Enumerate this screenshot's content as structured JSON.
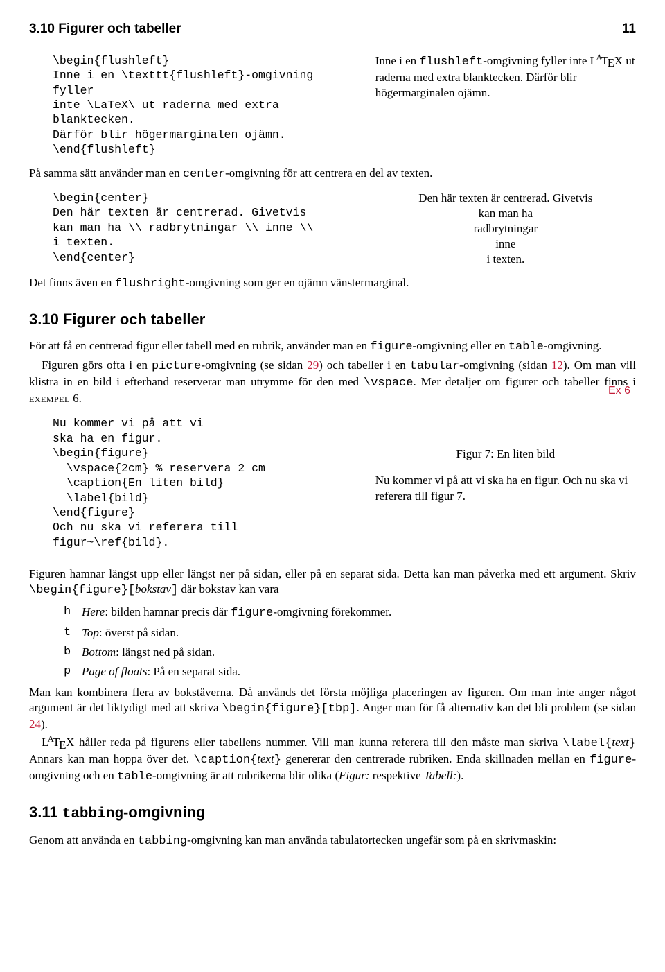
{
  "header": {
    "title": "3.10 Figurer och tabeller",
    "page": "11"
  },
  "ex1": {
    "code": "\\begin{flushleft}\nInne i en \\texttt{flushleft}-omgivning fyller\ninte \\LaTeX\\ ut raderna med extra blanktecken.\nDärför blir högermarginalen ojämn.\n\\end{flushleft}",
    "out_a": "Inne i en ",
    "out_a_tt": "flushleft",
    "out_b": "-omgivning fyller inte ",
    "out_c": " ut raderna med extra blanktecken. Därför blir högermarginalen ojämn."
  },
  "p1_a": "På samma sätt använder man en ",
  "p1_tt": "center",
  "p1_b": "-omgivning för att centrera en del av texten.",
  "ex2": {
    "code": "\\begin{center}\nDen här texten är centrerad. Givetvis\nkan man ha \\\\ radbrytningar \\\\ inne \\\\\ni texten.\n\\end{center}",
    "out_l1": "Den här texten är centrerad. Givetvis",
    "out_l2": "kan man ha",
    "out_l3": "radbrytningar",
    "out_l4": "inne",
    "out_l5": "i texten."
  },
  "p2_a": "Det finns även en ",
  "p2_tt": "flushright",
  "p2_b": "-omgivning som ger en ojämn vänstermarginal.",
  "s310": {
    "heading": "3.10   Figurer och tabeller",
    "p1_a": "För att få en centrerad figur eller tabell med en rubrik, använder man en ",
    "p1_tt1": "figure",
    "p1_b": "-omgivning eller en ",
    "p1_tt2": "table",
    "p1_c": "-omgivning.",
    "p2_a": "Figuren görs ofta i en ",
    "p2_tt1": "picture",
    "p2_b": "-omgivning (se sidan ",
    "p2_ln1": "29",
    "p2_c": ") och tabeller i en ",
    "p2_tt2": "tabular",
    "p2_d": "-omgivning (sidan ",
    "p2_ln2": "12",
    "p2_e": "). Om man vill klistra in en bild i efterhand reserverar man utrymme för den med ",
    "p2_tt3": "\\vspace",
    "p2_f": ". Mer detaljer om figurer och tabeller finns i ",
    "p2_sc": "exempel",
    "p2_g": " 6.",
    "margin": "Ex 6"
  },
  "ex3": {
    "code": "Nu kommer vi på att vi\nska ha en figur.\n\\begin{figure}\n  \\vspace{2cm} % reservera 2 cm\n  \\caption{En liten bild}\n  \\label{bild}\n\\end{figure}\nOch nu ska vi referera till\nfigur~\\ref{bild}.",
    "out_cap": "Figur 7: En liten bild",
    "out_txt": "Nu kommer vi på att vi ska ha en figur. Och nu ska vi referera till figur 7."
  },
  "p3_a": "Figuren hamnar längst upp eller längst ner på sidan, eller på en separat sida. Detta kan man påverka med ett argument. Skriv ",
  "p3_tt": "\\begin{figure}[",
  "p3_it": "bokstav",
  "p3_tt2": "]",
  "p3_b": " där bokstav kan vara",
  "list": {
    "h_key": "h",
    "h_it": "Here",
    "h_txt": ": bilden hamnar precis där ",
    "h_tt": "figure",
    "h_txt2": "-omgivning förekommer.",
    "t_key": "t",
    "t_it": "Top",
    "t_txt": ": överst på sidan.",
    "b_key": "b",
    "b_it": "Bottom",
    "b_txt": ": längst ned på sidan.",
    "p_key": "p",
    "p_it": "Page of floats",
    "p_txt": ": På en separat sida."
  },
  "p4_a": "Man kan kombinera flera av bokstäverna. Då används det första möjliga placeringen av figuren. Om man inte anger något argument är det liktydigt med att skriva ",
  "p4_tt": "\\begin{figure}[tbp]",
  "p4_b": ". Anger man för få alternativ kan det bli problem (se sidan ",
  "p4_ln": "24",
  "p4_c": ").",
  "p5_a": " håller reda på figurens eller tabellens nummer. Vill man kunna referera till den måste man skriva ",
  "p5_tt1": "\\label{",
  "p5_it1": "text",
  "p5_tt1b": "}",
  "p5_b": " Annars kan man hoppa över det. ",
  "p5_tt2": "\\caption{",
  "p5_it2": "text",
  "p5_tt2b": "}",
  "p5_c": " genererar den centrerade rubriken. Enda skillnaden mellan en ",
  "p5_tt3": "figure",
  "p5_d": "-omgivning och en ",
  "p5_tt4": "table",
  "p5_e": "-omgivning är att rubrikerna blir olika (",
  "p5_it3": "Figur:",
  "p5_f": " respektive ",
  "p5_it4": "Tabell:",
  "p5_g": ").",
  "s311": {
    "heading_num": "3.11   ",
    "heading_tt": "tabbing",
    "heading_rest": "-omgivning",
    "p_a": "Genom att använda en ",
    "p_tt": "tabbing",
    "p_b": "-omgivning kan man använda tabulatortecken ungefär som på en skrivmaskin:"
  }
}
